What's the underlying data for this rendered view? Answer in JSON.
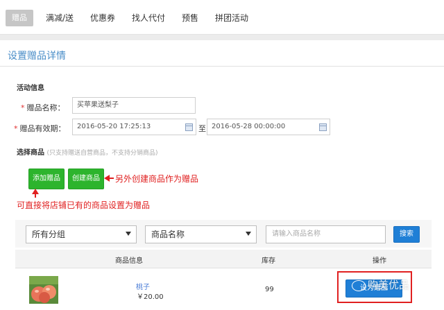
{
  "tabs": [
    {
      "label": "赠品",
      "active": true
    },
    {
      "label": "满减/送"
    },
    {
      "label": "优惠券"
    },
    {
      "label": "找人代付"
    },
    {
      "label": "预售"
    },
    {
      "label": "拼团活动"
    }
  ],
  "page_title": "设置赠品详情",
  "activity_section": {
    "heading": "活动信息",
    "name_label": "赠品名称：",
    "name_value": "买苹果送梨子",
    "validity_label": "赠品有效期：",
    "start_date": "2016-05-20 17:25:13",
    "to_text": "至",
    "end_date": "2016-05-28 00:00:00"
  },
  "product_section": {
    "heading": "选择商品",
    "hint": "(只支持赠送自营商品，不支持分销商品)",
    "add_button": "添加赠品",
    "create_button": "创建商品"
  },
  "annotations": {
    "create": "另外创建商品作为赠品",
    "add": "可直接将店铺已有的商品设置为赠品"
  },
  "filter": {
    "group_select": "所有分组",
    "field_select": "商品名称",
    "search_placeholder": "请输入商品名称",
    "search_button": "搜索"
  },
  "table": {
    "headers": [
      "商品信息",
      "库存",
      "操作"
    ],
    "rows": [
      {
        "name": "桃子",
        "price": "￥20.00",
        "stock": "99",
        "action": "设为赠品"
      }
    ]
  },
  "watermark": "购美优品",
  "colors": {
    "accent_blue": "#1f7fd6",
    "title_blue": "#4a8ec8",
    "button_green": "#2db42d",
    "annotation_red": "#e02020"
  }
}
